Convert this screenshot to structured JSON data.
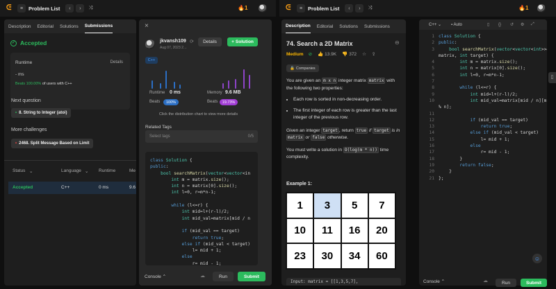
{
  "left_window": {
    "problem_list_label": "Problem List",
    "streak": "1",
    "tabs": [
      "Description",
      "Editorial",
      "Solutions",
      "Submissions"
    ],
    "accepted": "Accepted",
    "runtime_label": "Runtime",
    "details_label": "Details",
    "runtime_value": "- ms",
    "beats_highlight": "Beats 100.00%",
    "beats_rest": "of users with C++",
    "next_question_label": "Next question",
    "next_question": "8. String to Integer (atoi)",
    "more_challenges_label": "More challenges",
    "more_challenge": "2468. Split Message Based on Limit",
    "table_headers": [
      "Status",
      "Language",
      "Runtime",
      "Me"
    ],
    "row": {
      "status": "Accepted",
      "language": "C++",
      "runtime": "0 ms",
      "memory": "9.6"
    },
    "submission": {
      "user": "jkvansh109",
      "date": "Aug 07, 2023 2…",
      "details_button": "Details",
      "solution_button": "Solution",
      "lang_badge": "C++",
      "runtime_label": "Runtime",
      "runtime_value": "0 ms",
      "memory_label": "Memory",
      "memory_value": "9.6 MB",
      "beats_label": "Beats",
      "beats_runtime": "100%",
      "beats_memory": "19.73%",
      "chart_hint": "Click the distribution chart to view more details",
      "related_tags_label": "Related Tags",
      "tags_placeholder": "Select tags",
      "tags_count": "0/5"
    },
    "console_label": "Console",
    "run_label": "Run",
    "submit_label": "Submit"
  },
  "right_window": {
    "problem_list_label": "Problem List",
    "streak": "1",
    "tabs": [
      "Description",
      "Editorial",
      "Solutions",
      "Submissions"
    ],
    "problem_title": "74. Search a 2D Matrix",
    "difficulty": "Medium",
    "likes": "13.9K",
    "dislikes": "372",
    "companies": "Companies",
    "desc_1a": "You are given an ",
    "desc_1_code1": "m x n",
    "desc_1b": " integer matrix ",
    "desc_1_code2": "matrix",
    "desc_1c": " with the following two properties:",
    "bullet_1": "Each row is sorted in non-decreasing order.",
    "bullet_2": "The first integer of each row is greater than the last integer of the previous row.",
    "desc_2a": "Given an integer ",
    "desc_2_code1": "target",
    "desc_2b": ", return ",
    "desc_2_code2": "true",
    "desc_2c": " if ",
    "desc_2_code3": "target",
    "desc_2d": " is in ",
    "desc_2_code4": "matrix",
    "desc_2e": " or ",
    "desc_2_code5": "false",
    "desc_2f": " otherwise.",
    "desc_3a": "You must write a solution in ",
    "desc_3_code": "O(log(m * n))",
    "desc_3b": " time complexity.",
    "example_label": "Example 1:",
    "matrix": [
      1,
      3,
      5,
      7,
      10,
      11,
      16,
      20,
      23,
      30,
      34,
      60
    ],
    "input_preview": "Input: matrix = [[1,3,5,7],",
    "editor_lang": "C++",
    "editor_mode": "Auto",
    "console_label": "Console",
    "run_label": "Run",
    "submit_label": "Submit"
  },
  "code_lines": [
    "class Solution {",
    "public:",
    "    bool searchMatrix(vector<vector<int>>&",
    "matrix, int target) {",
    "        int m = matrix.size();",
    "        int n = matrix[0].size();",
    "        int l=0, r=m*n-1;",
    "",
    "        while (l<=r) {",
    "            int mid=l+(r-l)/2;",
    "            int mid_val=matrix[mid / n][mid",
    "% n];",
    "",
    "            if (mid_val == target)",
    "                return true;",
    "            else if (mid_val < target)",
    "                l= mid + 1;",
    "            else",
    "                r= mid - 1;",
    "        }",
    "        return false;",
    "    }",
    "};"
  ],
  "line_numbers": [
    "1",
    "2",
    "3",
    "",
    "4",
    "5",
    "6",
    "7",
    "8",
    "9",
    "10",
    "",
    "11",
    "12",
    "13",
    "14",
    "15",
    "16",
    "17",
    "18",
    "19",
    "20",
    "21"
  ],
  "popup_code_lines": [
    "class Solution {",
    "public:",
    "    bool searchMatrix(vector<vector<in",
    "        int m = matrix.size();",
    "        int n = matrix[0].size();",
    "        int l=0, r=m*n-1;",
    "",
    "        while (l<=r) {",
    "            int mid=l+(r-l)/2;",
    "            int mid_val=matrix[mid / n",
    "",
    "            if (mid_val == target)",
    "                return true;",
    "            else if (mid_val < target)",
    "                l= mid + 1;",
    "            else",
    "                r= mid - 1;"
  ]
}
